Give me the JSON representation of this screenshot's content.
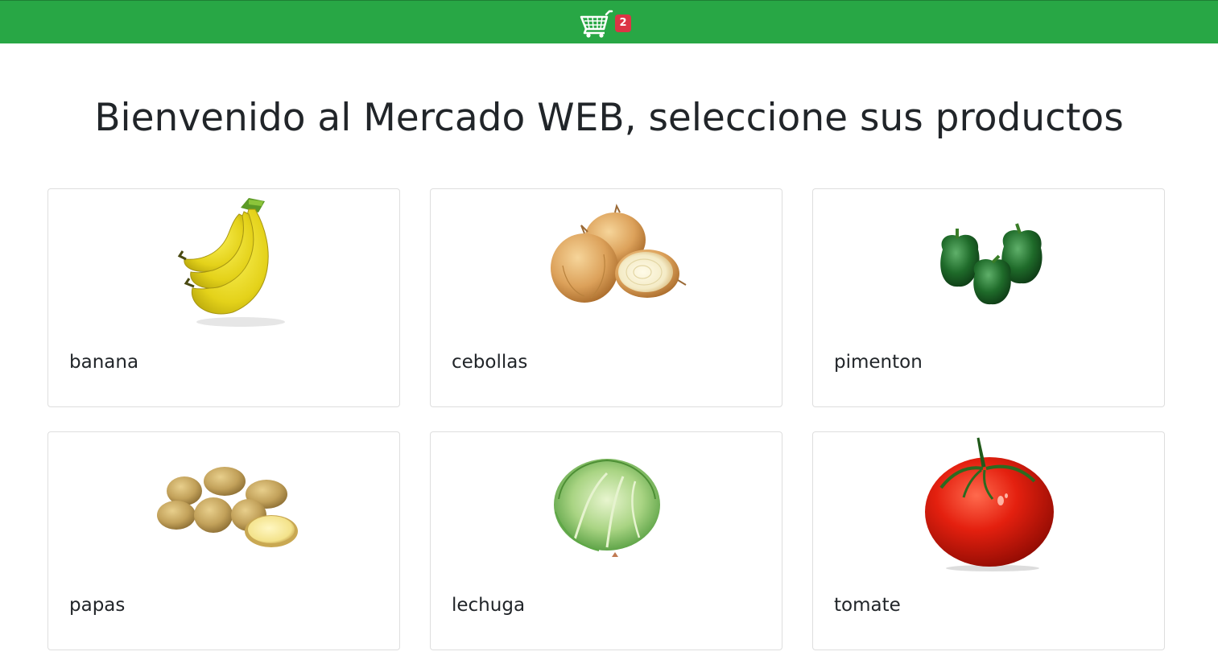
{
  "navbar": {
    "color": "#28a745",
    "cart": {
      "icon": "shopping-cart-icon",
      "count": "2",
      "badge_color": "#dc3545"
    }
  },
  "page": {
    "title": "Bienvenido al Mercado WEB, seleccione sus productos"
  },
  "products": [
    {
      "name": "banana",
      "image": "banana-image"
    },
    {
      "name": "cebollas",
      "image": "onion-image"
    },
    {
      "name": "pimenton",
      "image": "green-pepper-image"
    },
    {
      "name": "papas",
      "image": "potato-image"
    },
    {
      "name": "lechuga",
      "image": "lettuce-image"
    },
    {
      "name": "tomate",
      "image": "tomato-image"
    }
  ]
}
